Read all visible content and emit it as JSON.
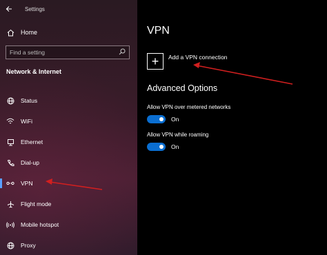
{
  "window": {
    "title": "Settings"
  },
  "sidebar": {
    "home_label": "Home",
    "search_placeholder": "Find a setting",
    "section_title": "Network & Internet",
    "items": [
      {
        "label": "Status",
        "icon": "globe-icon"
      },
      {
        "label": "WiFi",
        "icon": "wifi-icon"
      },
      {
        "label": "Ethernet",
        "icon": "ethernet-icon"
      },
      {
        "label": "Dial-up",
        "icon": "phone-icon"
      },
      {
        "label": "VPN",
        "icon": "vpn-icon",
        "active": true
      },
      {
        "label": "Flight mode",
        "icon": "airplane-icon"
      },
      {
        "label": "Mobile hotspot",
        "icon": "hotspot-icon"
      },
      {
        "label": "Proxy",
        "icon": "globe-icon"
      }
    ]
  },
  "main": {
    "page_title": "VPN",
    "add_vpn_label": "Add a VPN connection",
    "advanced_title": "Advanced Options",
    "options": [
      {
        "label": "Allow VPN over metered networks",
        "state": "On",
        "on": true
      },
      {
        "label": "Allow VPN while roaming",
        "state": "On",
        "on": true
      }
    ]
  },
  "colors": {
    "accent": "#0a6ed1",
    "annotation_arrow": "#d11f1f",
    "active_indicator": "#5aa0ff"
  }
}
